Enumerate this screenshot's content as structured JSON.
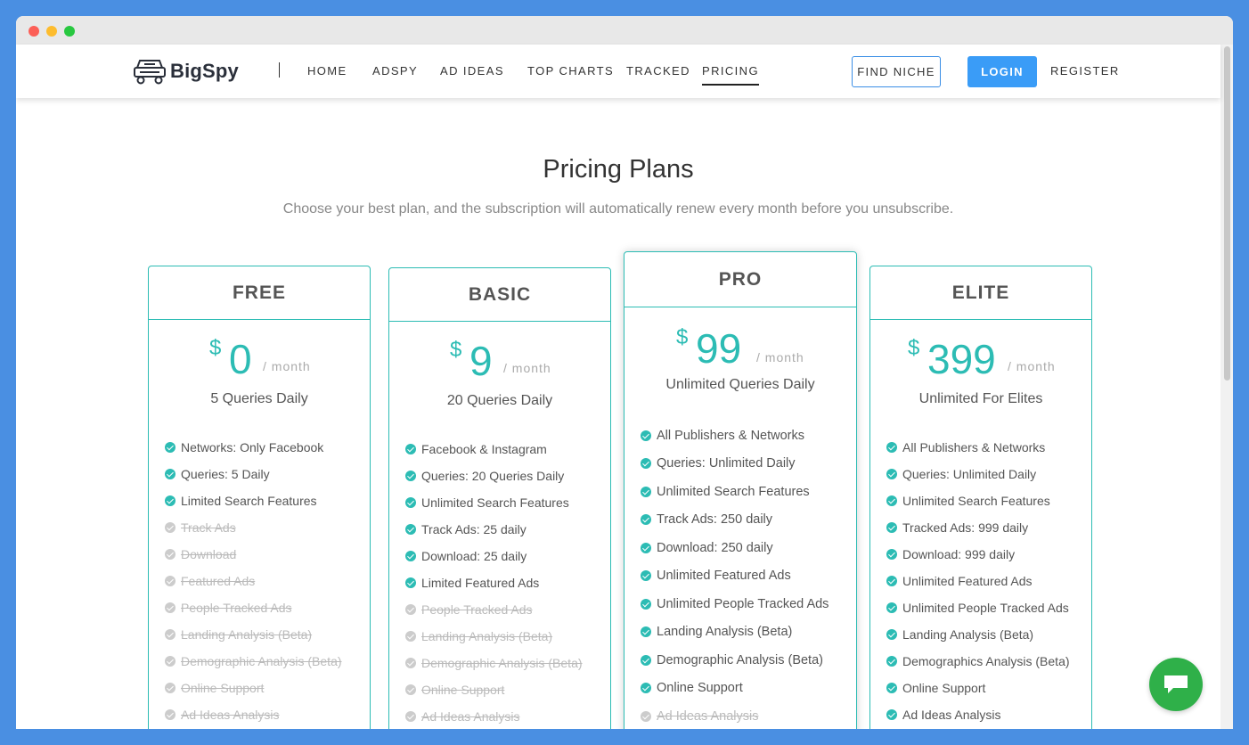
{
  "brand": {
    "name": "BigSpy"
  },
  "nav": {
    "items": [
      "HOME",
      "ADSPY",
      "AD IDEAS",
      "TOP CHARTS",
      "TRACKED",
      "PRICING"
    ],
    "active": "PRICING",
    "find_niche": "FIND NICHE",
    "login": "LOGIN",
    "register": "REGISTER"
  },
  "page": {
    "title": "Pricing Plans",
    "subtitle": "Choose your best plan, and the subscription will automatically renew every month before you unsubscribe."
  },
  "plans": [
    {
      "name": "FREE",
      "currency": "$",
      "price": "0",
      "period": "/ month",
      "queries": "5 Queries Daily",
      "features": [
        {
          "text": "Networks: Only Facebook",
          "enabled": true
        },
        {
          "text": "Queries: 5 Daily",
          "enabled": true
        },
        {
          "text": "Limited Search Features",
          "enabled": true
        },
        {
          "text": "Track Ads",
          "enabled": false
        },
        {
          "text": "Download",
          "enabled": false
        },
        {
          "text": "Featured Ads",
          "enabled": false
        },
        {
          "text": "People Tracked Ads",
          "enabled": false
        },
        {
          "text": "Landing Analysis (Beta)",
          "enabled": false
        },
        {
          "text": "Demographic Analysis (Beta)",
          "enabled": false
        },
        {
          "text": "Online Support",
          "enabled": false
        },
        {
          "text": "Ad Ideas Analysis",
          "enabled": false
        }
      ]
    },
    {
      "name": "BASIC",
      "currency": "$",
      "price": "9",
      "period": "/ month",
      "queries": "20 Queries Daily",
      "features": [
        {
          "text": "Facebook & Instagram",
          "enabled": true
        },
        {
          "text": "Queries: 20 Queries Daily",
          "enabled": true
        },
        {
          "text": "Unlimited Search Features",
          "enabled": true
        },
        {
          "text": "Track Ads: 25 daily",
          "enabled": true
        },
        {
          "text": "Download: 25 daily",
          "enabled": true
        },
        {
          "text": "Limited Featured Ads",
          "enabled": true
        },
        {
          "text": "People Tracked Ads",
          "enabled": false
        },
        {
          "text": "Landing Analysis (Beta)",
          "enabled": false
        },
        {
          "text": "Demographic Analysis (Beta)",
          "enabled": false
        },
        {
          "text": "Online Support",
          "enabled": false
        },
        {
          "text": "Ad Ideas Analysis",
          "enabled": false
        }
      ]
    },
    {
      "name": "PRO",
      "currency": "$",
      "price": "99",
      "period": "/ month",
      "queries": "Unlimited Queries Daily",
      "features": [
        {
          "text": "All Publishers & Networks",
          "enabled": true
        },
        {
          "text": "Queries: Unlimited Daily",
          "enabled": true
        },
        {
          "text": "Unlimited Search Features",
          "enabled": true
        },
        {
          "text": "Track Ads: 250 daily",
          "enabled": true
        },
        {
          "text": "Download: 250 daily",
          "enabled": true
        },
        {
          "text": "Unlimited Featured Ads",
          "enabled": true
        },
        {
          "text": "Unlimited People Tracked Ads",
          "enabled": true
        },
        {
          "text": "Landing Analysis (Beta)",
          "enabled": true
        },
        {
          "text": "Demographic Analysis (Beta)",
          "enabled": true
        },
        {
          "text": "Online Support",
          "enabled": true
        },
        {
          "text": "Ad Ideas Analysis",
          "enabled": false
        }
      ]
    },
    {
      "name": "ELITE",
      "currency": "$",
      "price": "399",
      "period": "/ month",
      "queries": "Unlimited For Elites",
      "features": [
        {
          "text": "All Publishers & Networks",
          "enabled": true
        },
        {
          "text": "Queries: Unlimited Daily",
          "enabled": true
        },
        {
          "text": "Unlimited Search Features",
          "enabled": true
        },
        {
          "text": "Tracked Ads: 999 daily",
          "enabled": true
        },
        {
          "text": "Download: 999 daily",
          "enabled": true
        },
        {
          "text": "Unlimited Featured Ads",
          "enabled": true
        },
        {
          "text": "Unlimited People Tracked Ads",
          "enabled": true
        },
        {
          "text": "Landing Analysis (Beta)",
          "enabled": true
        },
        {
          "text": "Demographics Analysis (Beta)",
          "enabled": true
        },
        {
          "text": "Online Support",
          "enabled": true
        },
        {
          "text": "Ad Ideas Analysis",
          "enabled": true
        }
      ]
    }
  ],
  "chat": {
    "icon": "chat-bubble-icon"
  },
  "colors": {
    "accent": "#2cbcb4",
    "login": "#3a9cf7",
    "frame": "#4a8fe2",
    "chat": "#2fb049"
  }
}
